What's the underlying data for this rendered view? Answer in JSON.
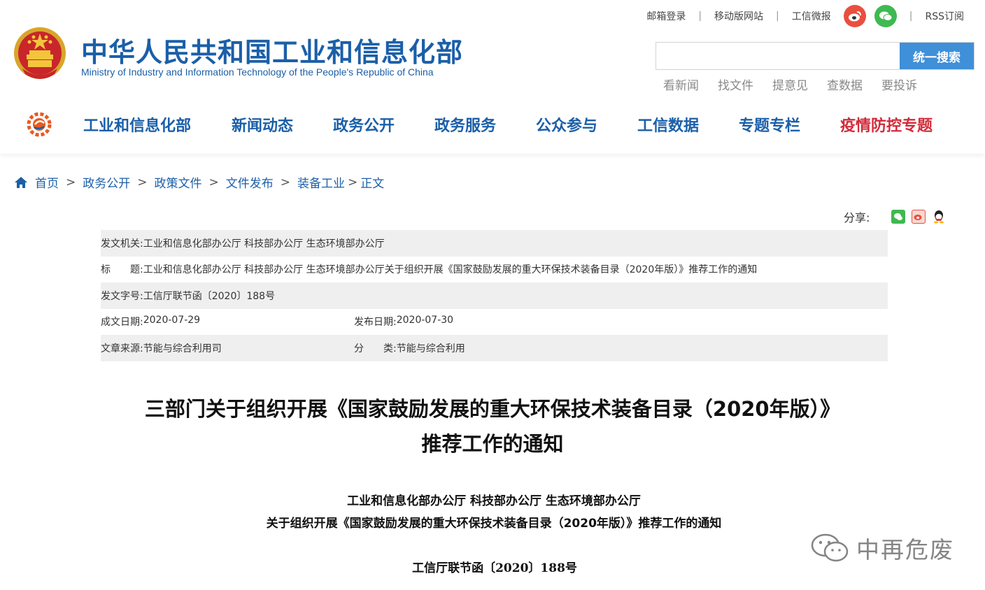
{
  "header": {
    "title_cn": "中华人民共和国工业和信息化部",
    "title_en": "Ministry of Industry and Information Technology of the People's Republic of China",
    "top_links": [
      "邮箱登录",
      "移动版网站",
      "工信微报"
    ],
    "rss": "RSS订阅",
    "search_placeholder": "",
    "search_button": "统一搜索",
    "quick_links": [
      "看新闻",
      "找文件",
      "提意见",
      "查数据",
      "要投诉"
    ],
    "icons": {
      "weibo": "weibo-icon",
      "wechat": "wechat-icon",
      "emblem": "national-emblem-icon"
    }
  },
  "nav": {
    "items": [
      "工业和信息化部",
      "新闻动态",
      "政务公开",
      "政务服务",
      "公众参与",
      "工信数据",
      "专题专栏",
      "疫情防控专题"
    ],
    "highlight_color": "#d22b3a",
    "primary_color": "#1b5fa8"
  },
  "breadcrumb": [
    "首页",
    "政务公开",
    "政策文件",
    "文件发布",
    "装备工业"
  ],
  "breadcrumb_last_sep": ">",
  "breadcrumb_current": "正文",
  "share_label": "分享:",
  "meta": {
    "issuing_agency_label": "发文机关:",
    "issuing_agency": "工业和信息化部办公厅 科技部办公厅 生态环境部办公厅",
    "title_label": "标　　题:",
    "title": "工业和信息化部办公厅 科技部办公厅 生态环境部办公厅关于组织开展《国家鼓励发展的重大环保技术装备目录（2020年版）》推荐工作的通知",
    "doc_no_label": "发文字号:",
    "doc_no": "工信厅联节函〔2020〕188号",
    "written_date_label": "成文日期:",
    "written_date": "2020-07-29",
    "publish_date_label": "发布日期:",
    "publish_date": "2020-07-30",
    "source_label": "文章来源:",
    "source": "节能与综合利用司",
    "category_label": "分　　类:",
    "category": "节能与综合利用"
  },
  "article": {
    "title_line1": "三部门关于组织开展《国家鼓励发展的重大环保技术装备目录（2020年版）》",
    "title_line2": "推荐工作的通知",
    "issuer": "工业和信息化部办公厅 科技部办公厅 生态环境部办公厅",
    "subtitle": "关于组织开展《国家鼓励发展的重大环保技术装备目录（2020年版）》推荐工作的通知",
    "doc_number": "工信厅联节函〔2020〕188号"
  },
  "watermark": "中再危废"
}
